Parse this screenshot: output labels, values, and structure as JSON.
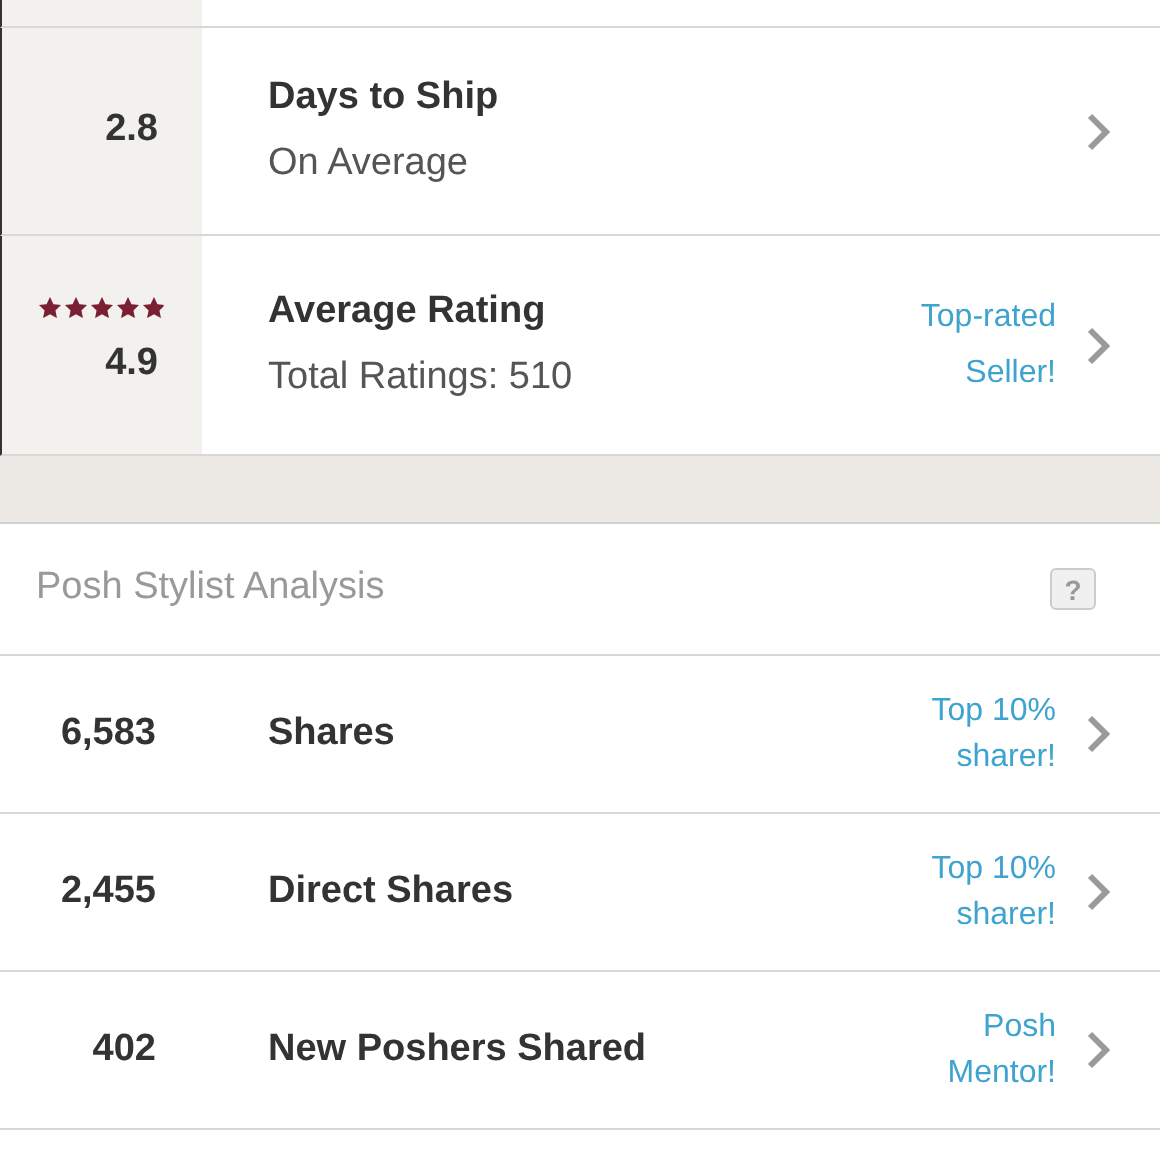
{
  "seller_stats": [
    {
      "kind": "number",
      "value": "2.8",
      "title": "Days to Ship",
      "subtitle": "On Average"
    },
    {
      "kind": "rating",
      "stars": 4.9,
      "value": "4.9",
      "title": "Average Rating",
      "subtitle": "Total Ratings: 510",
      "badge": "Top-rated Seller!"
    }
  ],
  "stylist": {
    "title": "Posh Stylist Analysis",
    "help": "?",
    "rows": [
      {
        "value": "6,583",
        "title": "Shares",
        "badge": "Top 10% sharer!"
      },
      {
        "value": "2,455",
        "title": "Direct Shares",
        "badge": "Top 10% sharer!"
      },
      {
        "value": "402",
        "title": "New Poshers Shared",
        "badge": "Posh Mentor!"
      }
    ]
  }
}
